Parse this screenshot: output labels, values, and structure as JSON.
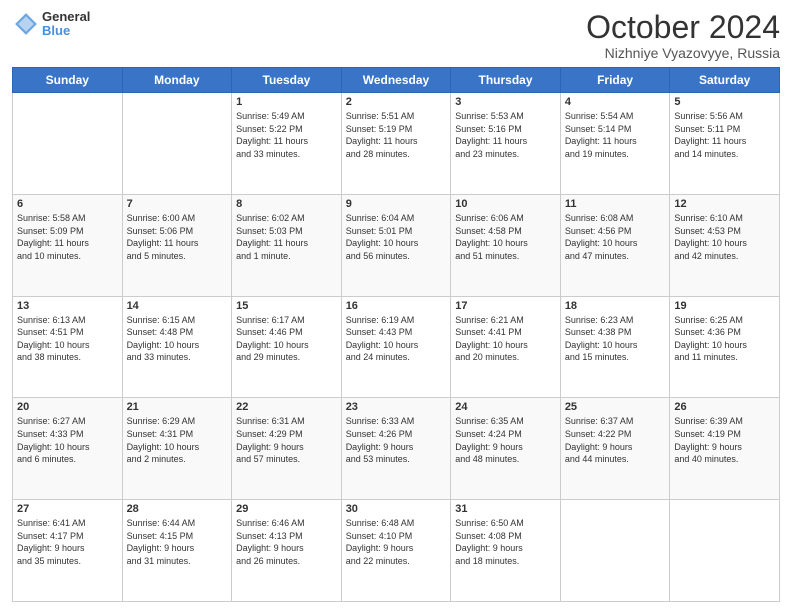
{
  "header": {
    "logo": {
      "line1": "General",
      "line2": "Blue"
    },
    "title": "October 2024",
    "subtitle": "Nizhniye Vyazovyye, Russia"
  },
  "weekdays": [
    "Sunday",
    "Monday",
    "Tuesday",
    "Wednesday",
    "Thursday",
    "Friday",
    "Saturday"
  ],
  "weeks": [
    [
      {
        "day": "",
        "info": ""
      },
      {
        "day": "",
        "info": ""
      },
      {
        "day": "1",
        "info": "Sunrise: 5:49 AM\nSunset: 5:22 PM\nDaylight: 11 hours\nand 33 minutes."
      },
      {
        "day": "2",
        "info": "Sunrise: 5:51 AM\nSunset: 5:19 PM\nDaylight: 11 hours\nand 28 minutes."
      },
      {
        "day": "3",
        "info": "Sunrise: 5:53 AM\nSunset: 5:16 PM\nDaylight: 11 hours\nand 23 minutes."
      },
      {
        "day": "4",
        "info": "Sunrise: 5:54 AM\nSunset: 5:14 PM\nDaylight: 11 hours\nand 19 minutes."
      },
      {
        "day": "5",
        "info": "Sunrise: 5:56 AM\nSunset: 5:11 PM\nDaylight: 11 hours\nand 14 minutes."
      }
    ],
    [
      {
        "day": "6",
        "info": "Sunrise: 5:58 AM\nSunset: 5:09 PM\nDaylight: 11 hours\nand 10 minutes."
      },
      {
        "day": "7",
        "info": "Sunrise: 6:00 AM\nSunset: 5:06 PM\nDaylight: 11 hours\nand 5 minutes."
      },
      {
        "day": "8",
        "info": "Sunrise: 6:02 AM\nSunset: 5:03 PM\nDaylight: 11 hours\nand 1 minute."
      },
      {
        "day": "9",
        "info": "Sunrise: 6:04 AM\nSunset: 5:01 PM\nDaylight: 10 hours\nand 56 minutes."
      },
      {
        "day": "10",
        "info": "Sunrise: 6:06 AM\nSunset: 4:58 PM\nDaylight: 10 hours\nand 51 minutes."
      },
      {
        "day": "11",
        "info": "Sunrise: 6:08 AM\nSunset: 4:56 PM\nDaylight: 10 hours\nand 47 minutes."
      },
      {
        "day": "12",
        "info": "Sunrise: 6:10 AM\nSunset: 4:53 PM\nDaylight: 10 hours\nand 42 minutes."
      }
    ],
    [
      {
        "day": "13",
        "info": "Sunrise: 6:13 AM\nSunset: 4:51 PM\nDaylight: 10 hours\nand 38 minutes."
      },
      {
        "day": "14",
        "info": "Sunrise: 6:15 AM\nSunset: 4:48 PM\nDaylight: 10 hours\nand 33 minutes."
      },
      {
        "day": "15",
        "info": "Sunrise: 6:17 AM\nSunset: 4:46 PM\nDaylight: 10 hours\nand 29 minutes."
      },
      {
        "day": "16",
        "info": "Sunrise: 6:19 AM\nSunset: 4:43 PM\nDaylight: 10 hours\nand 24 minutes."
      },
      {
        "day": "17",
        "info": "Sunrise: 6:21 AM\nSunset: 4:41 PM\nDaylight: 10 hours\nand 20 minutes."
      },
      {
        "day": "18",
        "info": "Sunrise: 6:23 AM\nSunset: 4:38 PM\nDaylight: 10 hours\nand 15 minutes."
      },
      {
        "day": "19",
        "info": "Sunrise: 6:25 AM\nSunset: 4:36 PM\nDaylight: 10 hours\nand 11 minutes."
      }
    ],
    [
      {
        "day": "20",
        "info": "Sunrise: 6:27 AM\nSunset: 4:33 PM\nDaylight: 10 hours\nand 6 minutes."
      },
      {
        "day": "21",
        "info": "Sunrise: 6:29 AM\nSunset: 4:31 PM\nDaylight: 10 hours\nand 2 minutes."
      },
      {
        "day": "22",
        "info": "Sunrise: 6:31 AM\nSunset: 4:29 PM\nDaylight: 9 hours\nand 57 minutes."
      },
      {
        "day": "23",
        "info": "Sunrise: 6:33 AM\nSunset: 4:26 PM\nDaylight: 9 hours\nand 53 minutes."
      },
      {
        "day": "24",
        "info": "Sunrise: 6:35 AM\nSunset: 4:24 PM\nDaylight: 9 hours\nand 48 minutes."
      },
      {
        "day": "25",
        "info": "Sunrise: 6:37 AM\nSunset: 4:22 PM\nDaylight: 9 hours\nand 44 minutes."
      },
      {
        "day": "26",
        "info": "Sunrise: 6:39 AM\nSunset: 4:19 PM\nDaylight: 9 hours\nand 40 minutes."
      }
    ],
    [
      {
        "day": "27",
        "info": "Sunrise: 6:41 AM\nSunset: 4:17 PM\nDaylight: 9 hours\nand 35 minutes."
      },
      {
        "day": "28",
        "info": "Sunrise: 6:44 AM\nSunset: 4:15 PM\nDaylight: 9 hours\nand 31 minutes."
      },
      {
        "day": "29",
        "info": "Sunrise: 6:46 AM\nSunset: 4:13 PM\nDaylight: 9 hours\nand 26 minutes."
      },
      {
        "day": "30",
        "info": "Sunrise: 6:48 AM\nSunset: 4:10 PM\nDaylight: 9 hours\nand 22 minutes."
      },
      {
        "day": "31",
        "info": "Sunrise: 6:50 AM\nSunset: 4:08 PM\nDaylight: 9 hours\nand 18 minutes."
      },
      {
        "day": "",
        "info": ""
      },
      {
        "day": "",
        "info": ""
      }
    ]
  ]
}
